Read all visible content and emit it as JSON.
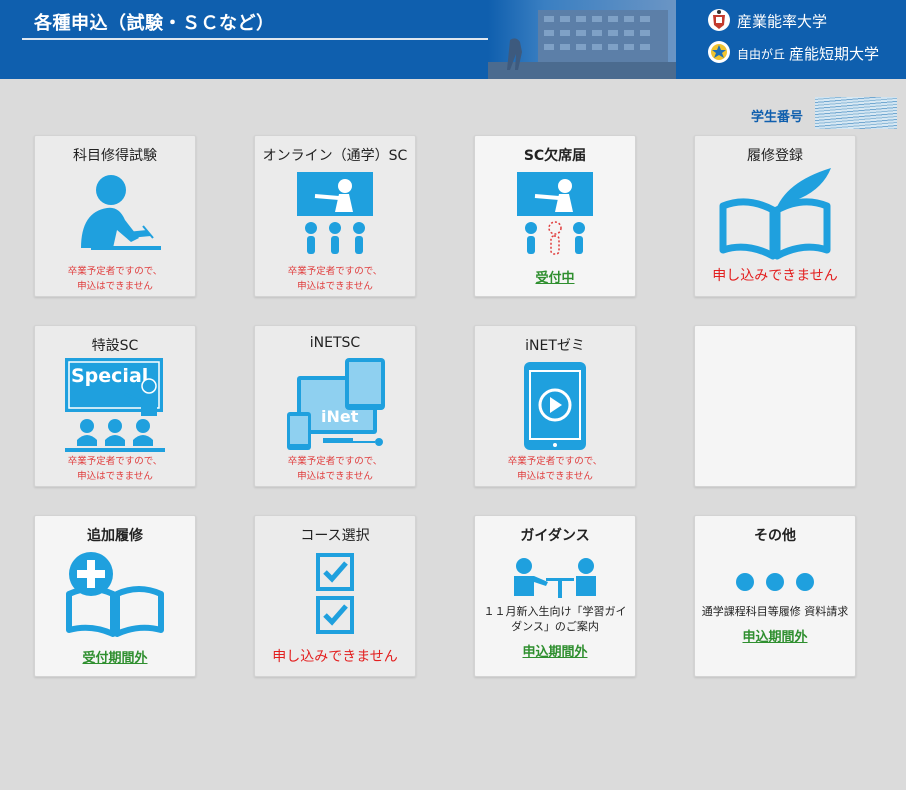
{
  "header": {
    "title": "各種申込（試験・ＳＣなど）",
    "brand_primary": "産業能率大学",
    "brand_sub_small": "自由が丘",
    "brand_sub": "産能短期大学"
  },
  "student": {
    "label": "学生番号"
  },
  "colors": {
    "header_bg": "#0f5fae",
    "icon_blue": "#1fa0de",
    "status_green": "#2f8f2f",
    "notice_red": "#e32020"
  },
  "cards": [
    {
      "title": "科目修得試験",
      "icon": "person-writing-icon",
      "note_line1": "卒業予定者ですので、",
      "note_line2": "申込はできません"
    },
    {
      "title": "オンライン（通学）SC",
      "icon": "lecture-audience-icon",
      "note_line1": "卒業予定者ですので、",
      "note_line2": "申込はできません"
    },
    {
      "title": "SC欠席届",
      "icon": "lecture-absent-icon",
      "status": "受付中"
    },
    {
      "title": "履修登録",
      "icon": "book-quill-icon",
      "notice": "申し込みできません"
    },
    {
      "title": "特設SC",
      "icon": "special-lecture-icon",
      "board_text": "Special",
      "note_line1": "卒業予定者ですので、",
      "note_line2": "申込はできません"
    },
    {
      "title": "iNETSC",
      "icon": "devices-inet-icon",
      "screen_text": "iNet",
      "note_line1": "卒業予定者ですので、",
      "note_line2": "申込はできません"
    },
    {
      "title": "iNETゼミ",
      "icon": "tablet-play-icon",
      "note_line1": "卒業予定者ですので、",
      "note_line2": "申込はできません"
    },
    {
      "title": "",
      "icon": ""
    },
    {
      "title": "追加履修",
      "icon": "book-plus-icon",
      "status": "受付期間外"
    },
    {
      "title": "コース選択",
      "icon": "checkboxes-icon",
      "notice": "申し込みできません"
    },
    {
      "title": "ガイダンス",
      "icon": "guidance-icon",
      "desc": "１１月新入生向け「学習ガイダンス」のご案内",
      "status": "申込期間外"
    },
    {
      "title": "その他",
      "icon": "more-dots-icon",
      "desc": "通学課程科目等履修 資料請求",
      "status": "申込期間外"
    }
  ]
}
